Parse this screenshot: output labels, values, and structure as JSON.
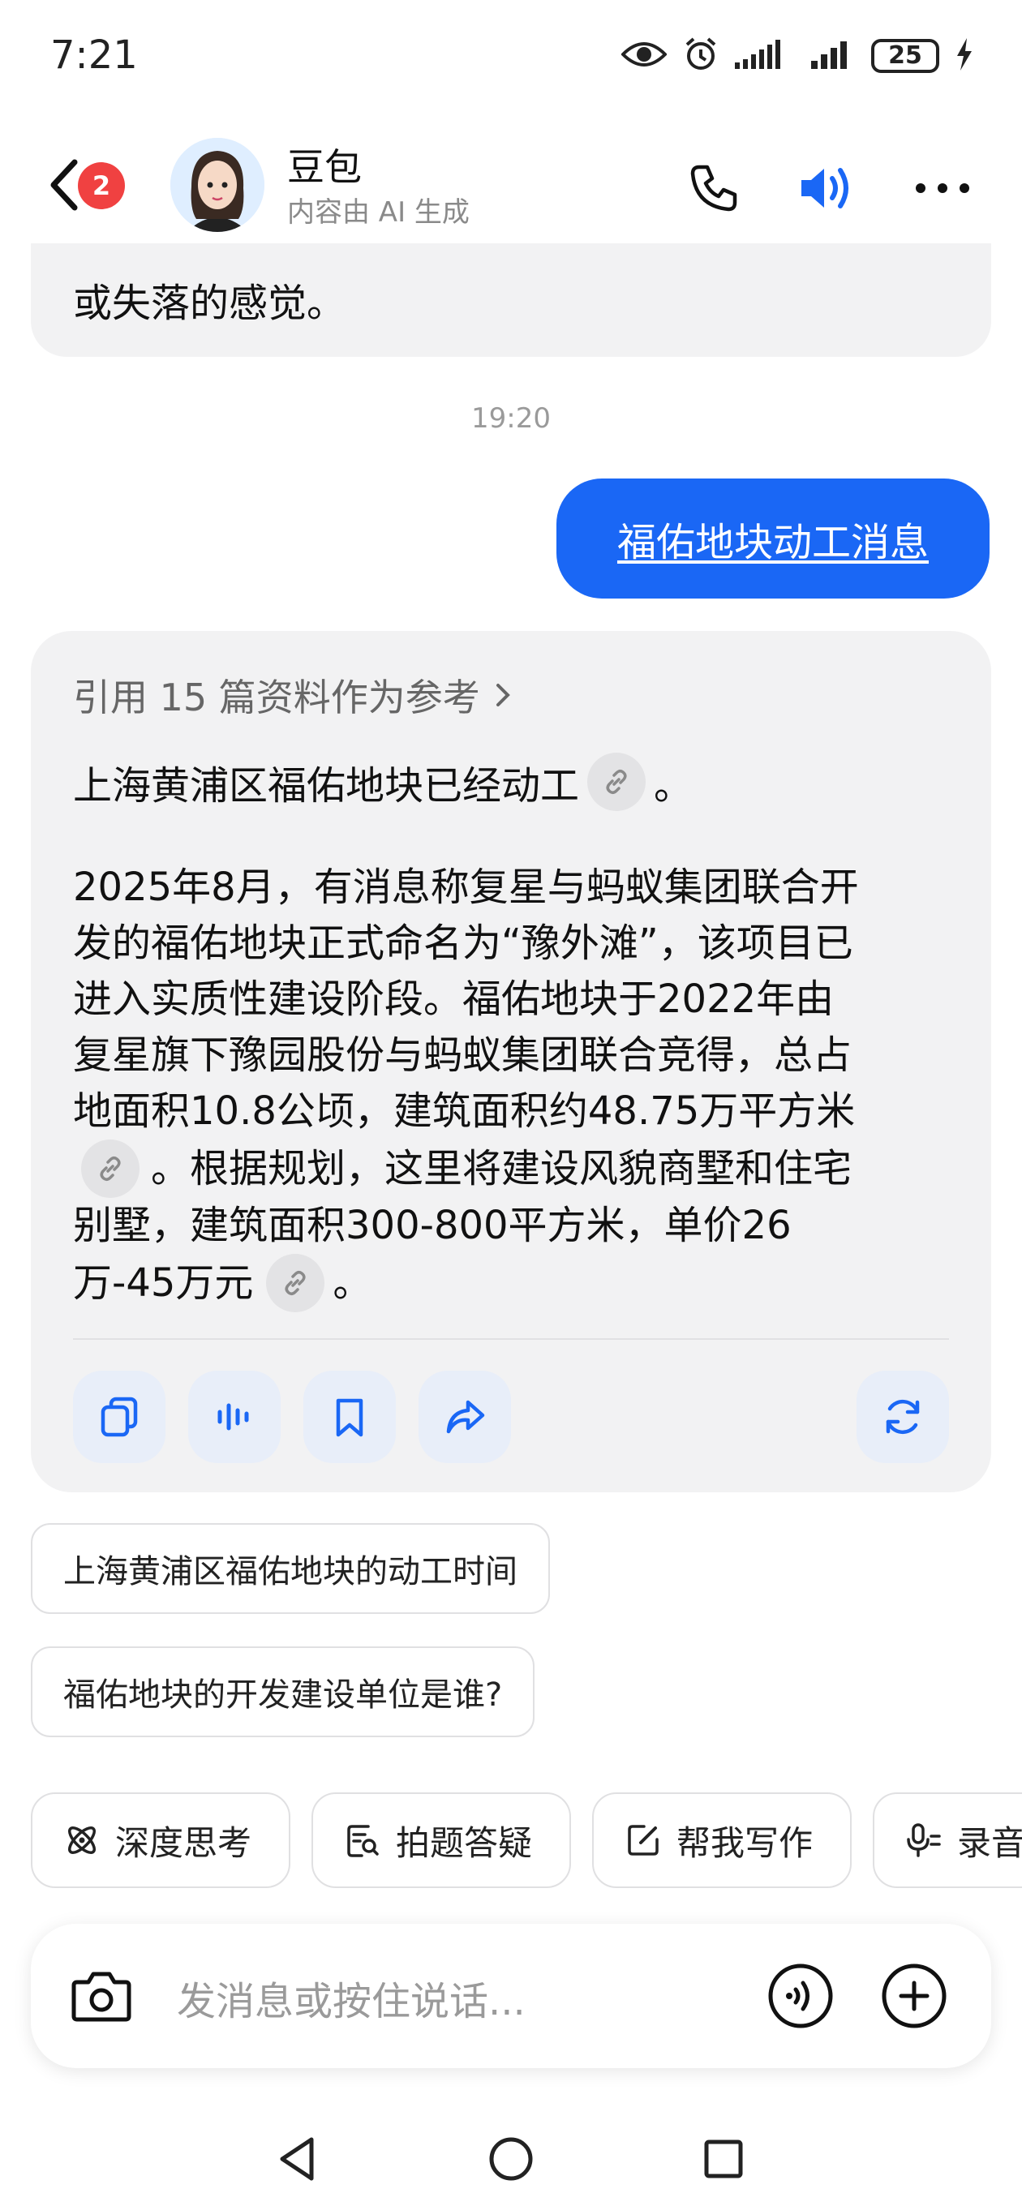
{
  "status_bar": {
    "time": "7:21",
    "battery": "25",
    "icons": [
      "eye-icon",
      "alarm-icon",
      "signal-icon",
      "signal-icon",
      "battery-icon",
      "charging-icon"
    ]
  },
  "header": {
    "badge": "2",
    "bot_name": "豆包",
    "bot_subtitle": "内容由 AI 生成"
  },
  "chat": {
    "previous_text": "或失落的感觉。",
    "timestamp": "19:20",
    "user_message": "福佑地块动工消息",
    "answer": {
      "references": "引用 15 篇资料作为参考",
      "line1": "上海黄浦区福佑地块已经动工",
      "line1_end": "。",
      "lines": [
        "2025年8月，有消息称复星与蚂蚁集团联合开",
        "发的福佑地块正式命名为“豫外滩”，该项目已",
        "进入实质性建设阶段。福佑地块于2022年由",
        "复星旗下豫园股份与蚂蚁集团联合竞得，总占",
        "地面积10.8公顷，建筑面积约48.75万平方米",
        "。根据规划，这里将建设风貌商墅和住宅",
        "别墅，建筑面积300-800平方米，单价26",
        "万-45万元",
        "。"
      ]
    }
  },
  "suggestions": [
    "上海黄浦区福佑地块的动工时间",
    "福佑地块的开发建设单位是谁?"
  ],
  "tools": [
    "深度思考",
    "拍题答疑",
    "帮我写作",
    "录音"
  ],
  "input": {
    "placeholder": "发消息或按住说话..."
  },
  "colors": {
    "accent": "#1a67f5",
    "bubble_bg": "#f2f2f3",
    "action_bg": "#e8eef9",
    "badge": "#f04141"
  }
}
